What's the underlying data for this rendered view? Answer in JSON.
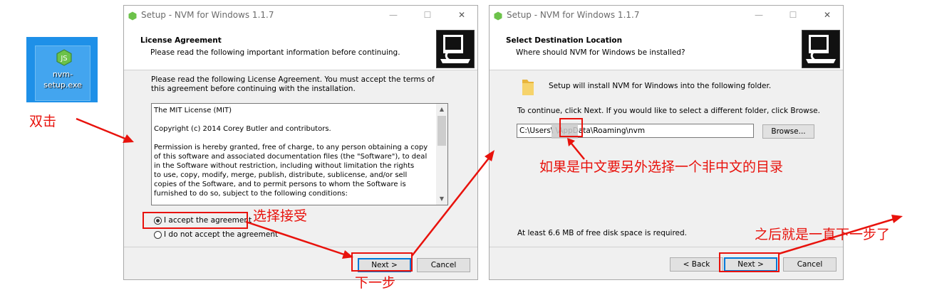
{
  "desktop": {
    "file_name": "nvm-setup.exe"
  },
  "left_window": {
    "title": "Setup - NVM for Windows 1.1.7",
    "header_title": "License Agreement",
    "header_subtitle": "Please read the following important information before continuing.",
    "intro": "Please read the following License Agreement. You must accept the terms of this agreement before continuing with the installation.",
    "license_lines": [
      "The MIT License (MIT)",
      "",
      "Copyright (c) 2014 Corey Butler and contributors.",
      "",
      "Permission is hereby granted, free of charge, to any person obtaining a copy",
      "of this software and associated documentation files (the \"Software\"), to deal",
      "in the Software without restriction, including without limitation the rights",
      "to use, copy, modify, merge, publish, distribute, sublicense, and/or sell",
      "copies of the Software, and to permit persons to whom the Software is",
      "furnished to do so, subject to the following conditions:"
    ],
    "accept_label": "I accept the agreement",
    "decline_label": "I do not accept the agreement",
    "next_label": "Next >",
    "cancel_label": "Cancel"
  },
  "right_window": {
    "title": "Setup - NVM for Windows 1.1.7",
    "header_title": "Select Destination Location",
    "header_subtitle": "Where should NVM for Windows be installed?",
    "info": "Setup will install NVM for Windows into the following folder.",
    "instruction": "To continue, click Next. If you would like to select a different folder, click Browse.",
    "path_value": "C:\\Users\\     \\AppData\\Roaming\\nvm",
    "browse_label": "Browse...",
    "disk_space": "At least 6.6 MB of free disk space is required.",
    "back_label": "< Back",
    "next_label": "Next >",
    "cancel_label": "Cancel"
  },
  "annotations": {
    "double_click": "双击",
    "select_accept": "选择接受",
    "next_step": "下一步",
    "chinese_path_note": "如果是中文要另外选择一个非中文的目录",
    "then_next": "之后就是一直下一步了"
  },
  "colors": {
    "annotation": "#e8120c",
    "desktop_icon_bg": "#1e90e8",
    "default_button_border": "#0078d7"
  }
}
